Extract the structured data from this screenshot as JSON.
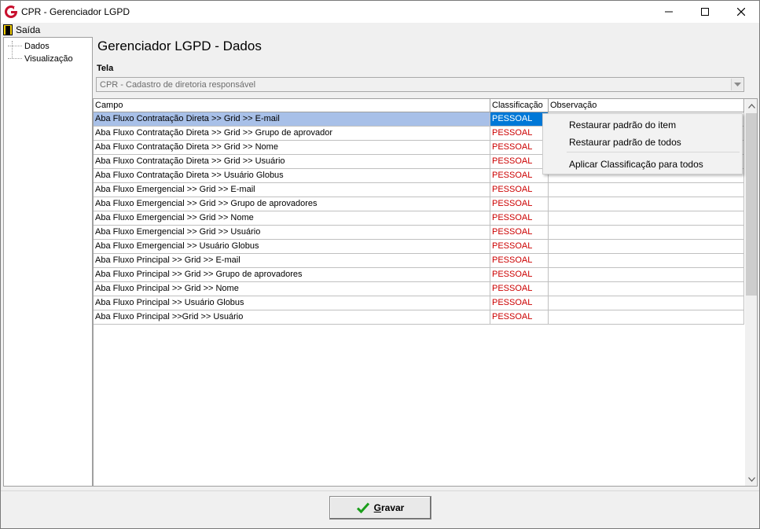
{
  "window": {
    "title": "CPR - Gerenciador LGPD",
    "minimize_icon": "minimize-icon",
    "maximize_icon": "maximize-icon",
    "close_icon": "close-icon"
  },
  "menu": {
    "exit_label": "Saída",
    "exit_icon": "door-exit-icon"
  },
  "tree": {
    "items": [
      {
        "label": "Dados"
      },
      {
        "label": "Visualização"
      }
    ]
  },
  "page": {
    "title": "Gerenciador LGPD - Dados",
    "tela_label": "Tela",
    "tela_value": "CPR - Cadastro de diretoria responsável"
  },
  "grid": {
    "columns": [
      "Campo",
      "Classificação",
      "Observação"
    ],
    "rows": [
      {
        "campo": "Aba Fluxo Contratação Direta >> Grid >> E-mail",
        "classificacao": "PESSOAL",
        "observacao": ""
      },
      {
        "campo": "Aba Fluxo Contratação Direta >> Grid >> Grupo de aprovador",
        "classificacao": "PESSOAL",
        "observacao": ""
      },
      {
        "campo": "Aba Fluxo Contratação Direta >> Grid >> Nome",
        "classificacao": "PESSOAL",
        "observacao": ""
      },
      {
        "campo": "Aba Fluxo Contratação Direta >> Grid >> Usuário",
        "classificacao": "PESSOAL",
        "observacao": ""
      },
      {
        "campo": "Aba Fluxo Contratação Direta >> Usuário Globus",
        "classificacao": "PESSOAL",
        "observacao": ""
      },
      {
        "campo": "Aba Fluxo Emergencial >> Grid >> E-mail",
        "classificacao": "PESSOAL",
        "observacao": ""
      },
      {
        "campo": "Aba Fluxo Emergencial >> Grid >> Grupo de aprovadores",
        "classificacao": "PESSOAL",
        "observacao": ""
      },
      {
        "campo": "Aba Fluxo Emergencial >> Grid >> Nome",
        "classificacao": "PESSOAL",
        "observacao": ""
      },
      {
        "campo": "Aba Fluxo Emergencial >> Grid >> Usuário",
        "classificacao": "PESSOAL",
        "observacao": ""
      },
      {
        "campo": "Aba Fluxo Emergencial >> Usuário Globus",
        "classificacao": "PESSOAL",
        "observacao": ""
      },
      {
        "campo": "Aba Fluxo Principal >> Grid >> E-mail",
        "classificacao": "PESSOAL",
        "observacao": ""
      },
      {
        "campo": "Aba Fluxo Principal >> Grid >> Grupo de aprovadores",
        "classificacao": "PESSOAL",
        "observacao": ""
      },
      {
        "campo": "Aba Fluxo Principal >> Grid >> Nome",
        "classificacao": "PESSOAL",
        "observacao": ""
      },
      {
        "campo": "Aba Fluxo Principal >> Usuário Globus",
        "classificacao": "PESSOAL",
        "observacao": ""
      },
      {
        "campo": "Aba Fluxo Principal >>Grid >> Usuário",
        "classificacao": "PESSOAL",
        "observacao": ""
      }
    ]
  },
  "context_menu": {
    "items": [
      "Restaurar padrão do item",
      "Restaurar padrão de todos",
      "Aplicar Classificação para todos"
    ]
  },
  "footer": {
    "save_label": "Gravar",
    "save_icon": "checkmark-icon"
  },
  "colors": {
    "classification_text": "#cc0000",
    "selected_row": "#a8c0e8",
    "selected_cell": "#0078d7",
    "checkmark": "#1a9e1a",
    "app_icon": "#c8102e"
  }
}
